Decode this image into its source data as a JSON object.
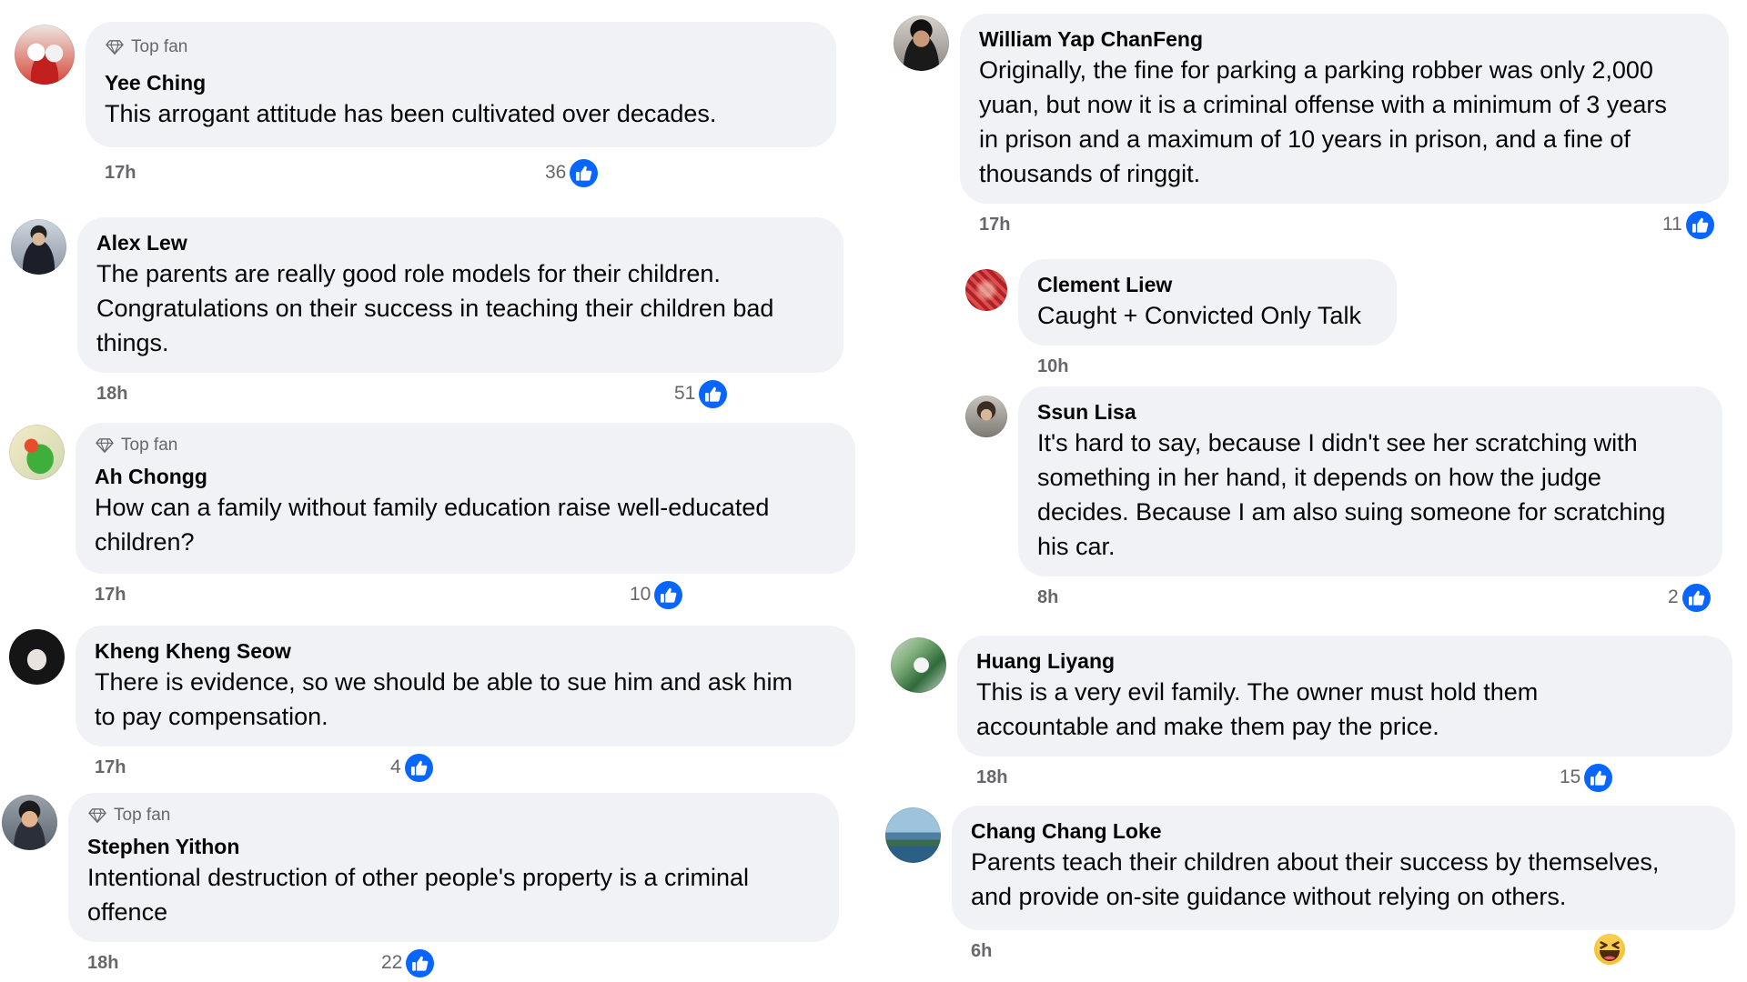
{
  "colors": {
    "bubble_background": "#f0f2f5",
    "primary_text": "#050505",
    "secondary_text": "#65676b",
    "like_blue": "#0866ff"
  },
  "left_column": {
    "comments": [
      {
        "author": "Yee Ching",
        "badge": {
          "label": "Top fan",
          "icon": "top-fan-icon"
        },
        "text_lines": [
          "This arrogant attitude has been cultivated over decades."
        ],
        "time": "17h",
        "reactions": {
          "icon": "like-icon",
          "count": 36
        }
      },
      {
        "author": "Alex Lew",
        "text_lines": [
          "The parents are really good role models for their children.",
          "Congratulations on their success in teaching their children bad",
          "things."
        ],
        "time": "18h",
        "reactions": {
          "icon": "like-icon",
          "count": 51
        }
      },
      {
        "author": "Ah Chongg",
        "badge": {
          "label": "Top fan",
          "icon": "top-fan-icon"
        },
        "text_lines": [
          "How can a family without family education raise well-educated",
          "children?"
        ],
        "time": "17h",
        "reactions": {
          "icon": "like-icon",
          "count": 10
        }
      },
      {
        "author": "Kheng Kheng Seow",
        "text_lines": [
          "There is evidence, so we should be able to sue him and ask him",
          "to pay compensation."
        ],
        "time": "17h",
        "reactions": {
          "icon": "like-icon",
          "count": 4
        }
      },
      {
        "author": "Stephen Yithon",
        "badge": {
          "label": "Top fan",
          "icon": "top-fan-icon"
        },
        "text_lines": [
          "Intentional destruction of other people's property is a criminal",
          "offence"
        ],
        "time": "18h",
        "reactions": {
          "icon": "like-icon",
          "count": 22
        }
      }
    ]
  },
  "right_column": {
    "comments": [
      {
        "author": "William Yap ChanFeng",
        "text_lines": [
          "Originally, the fine for parking a parking robber was only 2,000",
          "yuan, but now it is a criminal offense with a minimum of 3 years",
          "in prison and a maximum of 10 years in prison, and a fine of",
          "thousands of ringgit."
        ],
        "time": "17h",
        "reactions": {
          "icon": "like-icon",
          "count": 11
        },
        "replies": [
          {
            "author": "Clement Liew",
            "text_lines": [
              "Caught + Convicted Only Talk"
            ],
            "time": "10h"
          },
          {
            "author": "Ssun Lisa",
            "text_lines": [
              "It's hard to say, because I didn't see her scratching with",
              "something in her hand, it depends on how the judge",
              "decides. Because I am also suing someone for scratching",
              "his car."
            ],
            "time": "8h",
            "reactions": {
              "icon": "like-icon",
              "count": 2
            }
          }
        ]
      },
      {
        "author": "Huang Liyang",
        "text_lines": [
          "This is a very evil family. The owner must hold them",
          "accountable and make them pay the price."
        ],
        "time": "18h",
        "reactions": {
          "icon": "like-icon",
          "count": 15
        }
      },
      {
        "author": "Chang Chang Loke",
        "text_lines": [
          "Parents teach their children about their success by themselves,",
          "and provide on-site guidance without relying on others."
        ],
        "time": "6h",
        "reactions": {
          "icon": "haha-icon"
        }
      }
    ]
  }
}
